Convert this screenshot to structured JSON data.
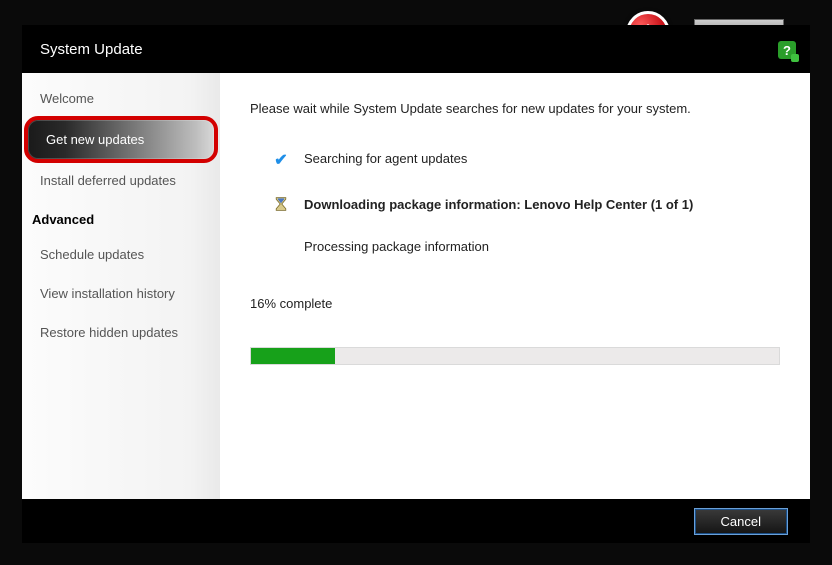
{
  "window": {
    "title": "System Update"
  },
  "sidebar": {
    "items": [
      {
        "label": "Welcome"
      },
      {
        "label": "Get new updates"
      },
      {
        "label": "Install deferred updates"
      }
    ],
    "advanced_heading": "Advanced",
    "advanced_items": [
      {
        "label": "Schedule updates"
      },
      {
        "label": "View installation history"
      },
      {
        "label": "Restore hidden updates"
      }
    ]
  },
  "main": {
    "intro": "Please wait while System Update searches for new updates for your system.",
    "status_agent": "Searching for agent updates",
    "status_download": "Downloading package information: Lenovo Help Center (1 of 1)",
    "status_processing": "Processing package information",
    "progress_label": "16% complete",
    "progress_percent": 16
  },
  "footer": {
    "cancel": "Cancel"
  }
}
